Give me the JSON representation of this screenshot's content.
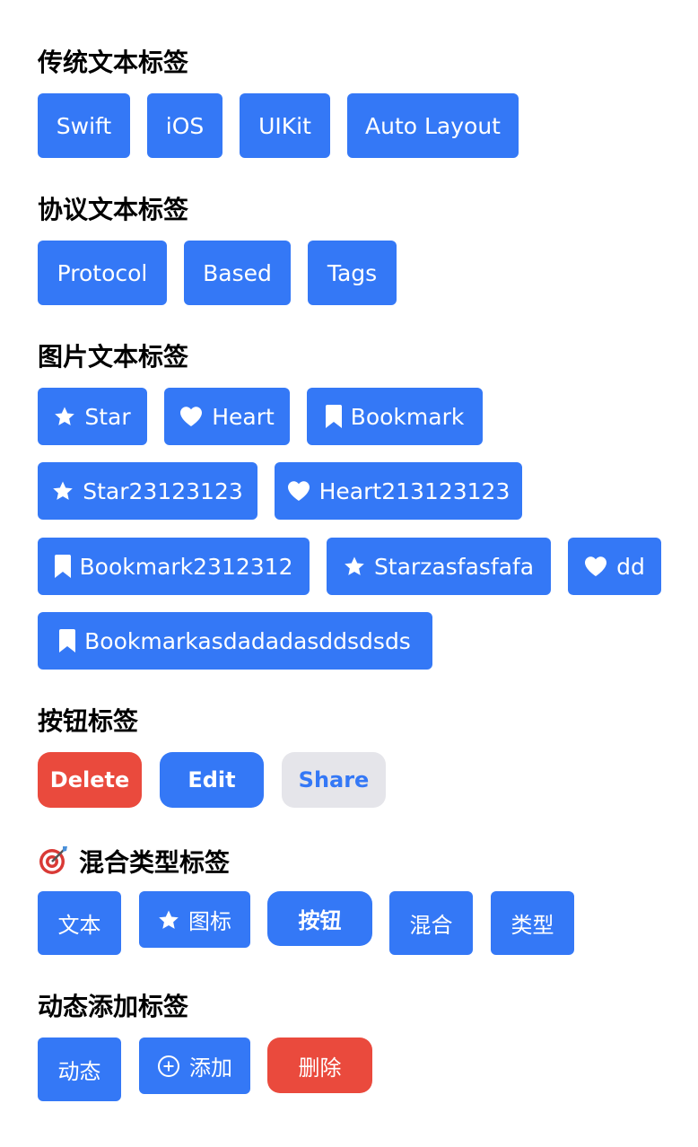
{
  "colors": {
    "accent": "#3478F6",
    "danger": "#EA4A3D",
    "secondary_bg": "#E5E5EA"
  },
  "sections": {
    "traditional": {
      "title": "传统文本标签",
      "tags": [
        "Swift",
        "iOS",
        "UIKit",
        "Auto Layout"
      ]
    },
    "protocol": {
      "title": "协议文本标签",
      "tags": [
        "Protocol",
        "Based",
        "Tags"
      ]
    },
    "image": {
      "title": "图片文本标签",
      "tags": [
        {
          "icon": "star-icon",
          "label": "Star"
        },
        {
          "icon": "heart-icon",
          "label": "Heart"
        },
        {
          "icon": "bookmark-icon",
          "label": "Bookmark"
        },
        {
          "icon": "star-icon",
          "label": "Star23123123"
        },
        {
          "icon": "heart-icon",
          "label": "Heart213123123"
        },
        {
          "icon": "bookmark-icon",
          "label": "Bookmark2312312"
        },
        {
          "icon": "star-icon",
          "label": "Starzasfasfafa"
        },
        {
          "icon": "heart-icon",
          "label": "dd"
        },
        {
          "icon": "bookmark-icon",
          "label": "Bookmarkasdadadasddsdsds"
        }
      ]
    },
    "buttons": {
      "title": "按钮标签",
      "tags": [
        "Delete",
        "Edit",
        "Share"
      ]
    },
    "mixed": {
      "title": "混合类型标签",
      "title_icon": "target-icon",
      "tags": [
        "文本",
        "图标",
        "按钮",
        "混合",
        "类型"
      ],
      "icon_tag_icon": "star-icon"
    },
    "dynamic": {
      "title": "动态添加标签",
      "tags": [
        "动态",
        "添加",
        "删除"
      ],
      "add_icon": "plus-circle-icon"
    }
  }
}
